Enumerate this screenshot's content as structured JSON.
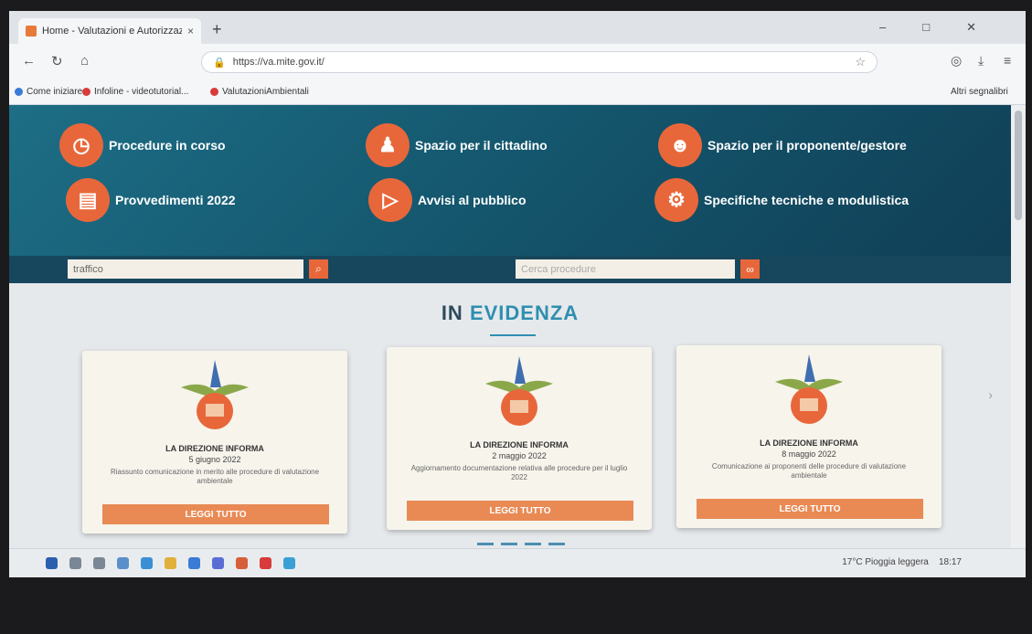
{
  "browser": {
    "tab_title": "Home - Valutazioni e Autorizzazioni Ambientali",
    "tab_close": "×",
    "new_tab": "+",
    "url": "https://va.mite.gov.it/",
    "bookmarks": [
      {
        "label": "Come iniziare",
        "color": "#3a7bd5"
      },
      {
        "label": "Infoline - videotutorial...",
        "color": "#d93a3a"
      },
      {
        "label": "ValutazioniAmbientali",
        "color": "#d93a3a"
      }
    ],
    "other_bookmarks": "Altri segnalibri"
  },
  "banner": {
    "items": [
      {
        "label": "Procedure in corso",
        "icon": "clock-icon"
      },
      {
        "label": "Spazio per il cittadino",
        "icon": "people-icon"
      },
      {
        "label": "Spazio per il proponente/gestore",
        "icon": "user-group-icon"
      },
      {
        "label": "Provvedimenti 2022",
        "icon": "document-icon"
      },
      {
        "label": "Avvisi al pubblico",
        "icon": "megaphone-icon"
      },
      {
        "label": "Specifiche tecniche e modulistica",
        "icon": "gears-icon"
      }
    ],
    "search_left_value": "traffico",
    "search_right_placeholder": "Cerca procedure"
  },
  "highlights": {
    "heading_prefix": "IN",
    "heading_highlight": "EVIDENZA",
    "cards": [
      {
        "title": "LA DIREZIONE INFORMA",
        "date": "5 giugno 2022",
        "text": "Riassunto comunicazione in merito alle procedure di valutazione ambientale",
        "button": "LEGGI TUTTO"
      },
      {
        "title": "LA DIREZIONE INFORMA",
        "date": "2 maggio 2022",
        "text": "Aggiornamento documentazione relativa alle procedure per il luglio 2022",
        "button": "LEGGI TUTTO"
      },
      {
        "title": "LA DIREZIONE INFORMA",
        "date": "8 maggio 2022",
        "text": "Comunicazione ai proponenti delle procedure di valutazione ambientale",
        "button": "LEGGI TUTTO"
      }
    ]
  },
  "taskbar": {
    "weather": "17°C Pioggia leggera",
    "time": "18:17"
  },
  "colors": {
    "banner": "#14566d",
    "accent": "#e8673a",
    "button": "#e98a55",
    "heading_highlight": "#2f8fb0"
  }
}
